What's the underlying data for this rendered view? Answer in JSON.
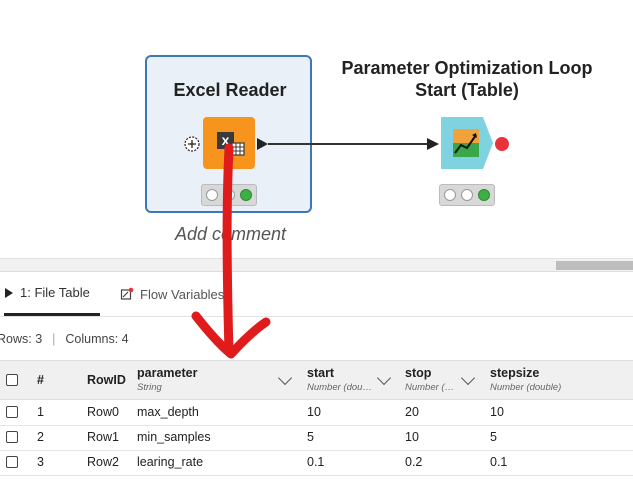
{
  "workflow": {
    "nodes": [
      {
        "title": "Excel Reader",
        "icon": "excel-reader-icon",
        "status": "executed"
      },
      {
        "title_line1": "Parameter Optimization Loop",
        "title_line2": "Start (Table)",
        "icon": "parameter-optimization-icon",
        "status": "executed"
      }
    ],
    "add_comment": "Add comment"
  },
  "panel": {
    "tabs": [
      {
        "label": "1: File Table",
        "icon": "play-icon",
        "active": true
      },
      {
        "label": "Flow Variables",
        "icon": "flow-variables-icon",
        "active": false
      }
    ],
    "rows_label": "Rows: 3",
    "columns_label": "Columns: 4"
  },
  "table": {
    "headers": {
      "index": "#",
      "rowid": "RowID",
      "columns": [
        {
          "name": "parameter",
          "type": "String"
        },
        {
          "name": "start",
          "type": "Number (dou…"
        },
        {
          "name": "stop",
          "type": "Number (…"
        },
        {
          "name": "stepsize",
          "type": "Number (double)"
        }
      ]
    },
    "rows": [
      {
        "index": "1",
        "rowid": "Row0",
        "parameter": "max_depth",
        "start": "10",
        "stop": "20",
        "stepsize": "10"
      },
      {
        "index": "2",
        "rowid": "Row1",
        "parameter": "min_samples",
        "start": "5",
        "stop": "10",
        "stepsize": "5"
      },
      {
        "index": "3",
        "rowid": "Row2",
        "parameter": "learing_rate",
        "start": "0.1",
        "stop": "0.2",
        "stepsize": "0.1"
      }
    ]
  },
  "colors": {
    "selection_border": "#3c78b8",
    "excel_node": "#f7941d",
    "optim_node": "#7fd3e0",
    "annotation_red": "#e01b1b",
    "status_green": "#3cb043"
  }
}
